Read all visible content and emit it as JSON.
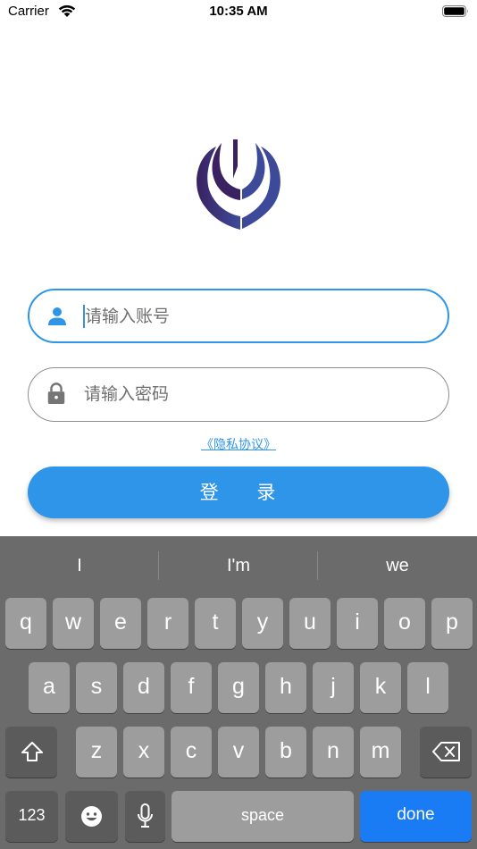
{
  "status_bar": {
    "carrier": "Carrier",
    "time": "10:35 AM"
  },
  "login": {
    "username_placeholder": "请输入账号",
    "password_placeholder": "请输入密码",
    "privacy_link": "《隐私协议》",
    "login_button": "登 录"
  },
  "icons": {
    "wifi": "wifi-icon",
    "battery": "battery-icon",
    "logo": "app-logo",
    "user": "user-icon",
    "lock": "lock-icon",
    "shift": "shift-icon",
    "backspace": "backspace-icon",
    "emoji": "emoji-icon",
    "mic": "microphone-icon"
  },
  "colors": {
    "accent": "#2f95e8",
    "keyboard_bg": "#6b6b6b",
    "key": "#9d9d9d",
    "done_key": "#1a7cf5"
  },
  "keyboard": {
    "suggestions": [
      "I",
      "I'm",
      "we"
    ],
    "row1": [
      "q",
      "w",
      "e",
      "r",
      "t",
      "y",
      "u",
      "i",
      "o",
      "p"
    ],
    "row2": [
      "a",
      "s",
      "d",
      "f",
      "g",
      "h",
      "j",
      "k",
      "l"
    ],
    "row3": [
      "z",
      "x",
      "c",
      "v",
      "b",
      "n",
      "m"
    ],
    "numbers_key": "123",
    "space_key": "space",
    "done_key": "done"
  }
}
